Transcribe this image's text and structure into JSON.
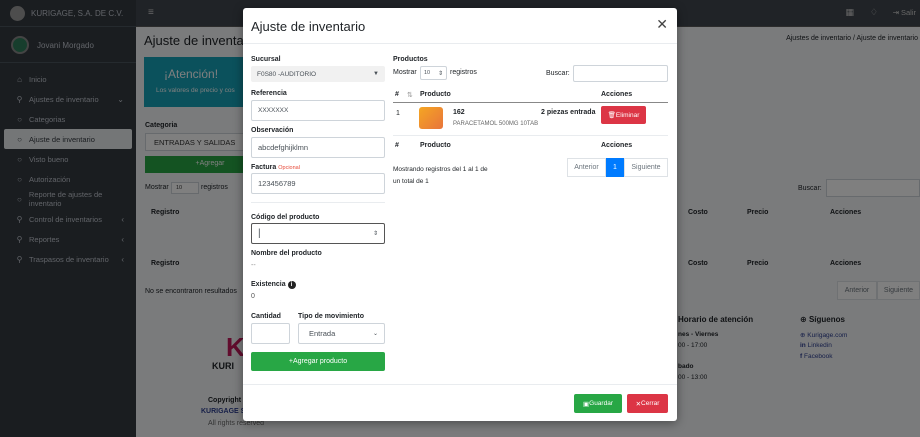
{
  "company": "KURIGAGE, S.A. DE C.V.",
  "user": "Jovani Morgado",
  "sidebar": {
    "items": [
      {
        "label": "Inicio"
      },
      {
        "label": "Ajustes de inventario"
      },
      {
        "label": "Categorias"
      },
      {
        "label": "Ajuste de inventario"
      },
      {
        "label": "Visto bueno"
      },
      {
        "label": "Autorización"
      },
      {
        "label": "Reporte de ajustes de inventario"
      },
      {
        "label": "Control de inventarios"
      },
      {
        "label": "Reportes"
      },
      {
        "label": "Traspasos de inventario"
      }
    ]
  },
  "topbar": {
    "logout": "Salir"
  },
  "page": {
    "title": "Ajuste de inventar",
    "breadcrumb": "Ajustes de inventario / Ajuste de inventario",
    "alert_title": "¡Atención!",
    "alert_text": "Los valores de precio y cos",
    "category_label": "Categoria",
    "category_value": "ENTRADAS Y SALIDAS",
    "add_button": "+Agregar",
    "show_label": "Mostrar",
    "show_value": "10",
    "records_label": "registros",
    "search_label": "Buscar:",
    "col_registro": "Registro",
    "col_costo": "Costo",
    "col_precio": "Precio",
    "col_acciones": "Acciones",
    "no_results": "No se encontraron resultados",
    "prev": "Anterior",
    "next": "Siguiente",
    "footer_schedule": "Horario de atención",
    "footer_weekdays": "nes - Viernes",
    "footer_weekdays_time": "00 - 17:00",
    "footer_saturday": "bado",
    "footer_saturday_time": "00 - 13:00",
    "footer_follow": "Síguenos",
    "footer_site": "Kurigage.com",
    "footer_linkedin": "Linkedin",
    "footer_facebook": "Facebook",
    "footer_copyright": "Copyright",
    "footer_company": "KURIGAGE S",
    "footer_rights": "All rights reserved"
  },
  "modal": {
    "title": "Ajuste de inventario",
    "sucursal_label": "Sucursal",
    "sucursal_value": "F0S80 -AUDITORIO",
    "referencia_label": "Referencia",
    "referencia_value": "XXXXXXX",
    "observacion_label": "Observación",
    "observacion_value": "abcdefghijklmn",
    "factura_label": "Factura",
    "factura_optional": "Opcional",
    "factura_value": "123456789",
    "codigo_label": "Código del producto",
    "codigo_value": "",
    "nombre_label": "Nombre del producto",
    "nombre_value": "--",
    "existencia_label": "Existencia",
    "existencia_value": "0",
    "cantidad_label": "Cantidad",
    "tipo_label": "Tipo de movimiento",
    "tipo_value": "Entrada",
    "add_product": "Agregar producto",
    "productos_label": "Productos",
    "mostrar": "Mostrar",
    "mostrar_value": "10",
    "registros": "registros",
    "buscar": "Buscar:",
    "col_num": "#",
    "col_producto": "Producto",
    "col_acciones": "Acciones",
    "row_num": "1",
    "row_code": "162",
    "row_desc": "PARACETAMOL 500MG 10TAB",
    "row_qty": "2 piezas entrada",
    "eliminar": "Eliminar",
    "showing_1": "Mostrando registros del 1 al 1 de",
    "showing_2": "un total de 1",
    "prev": "Anterior",
    "page": "1",
    "next": "Siguiente",
    "guardar": "Guardar",
    "cerrar": "Cerrar"
  }
}
